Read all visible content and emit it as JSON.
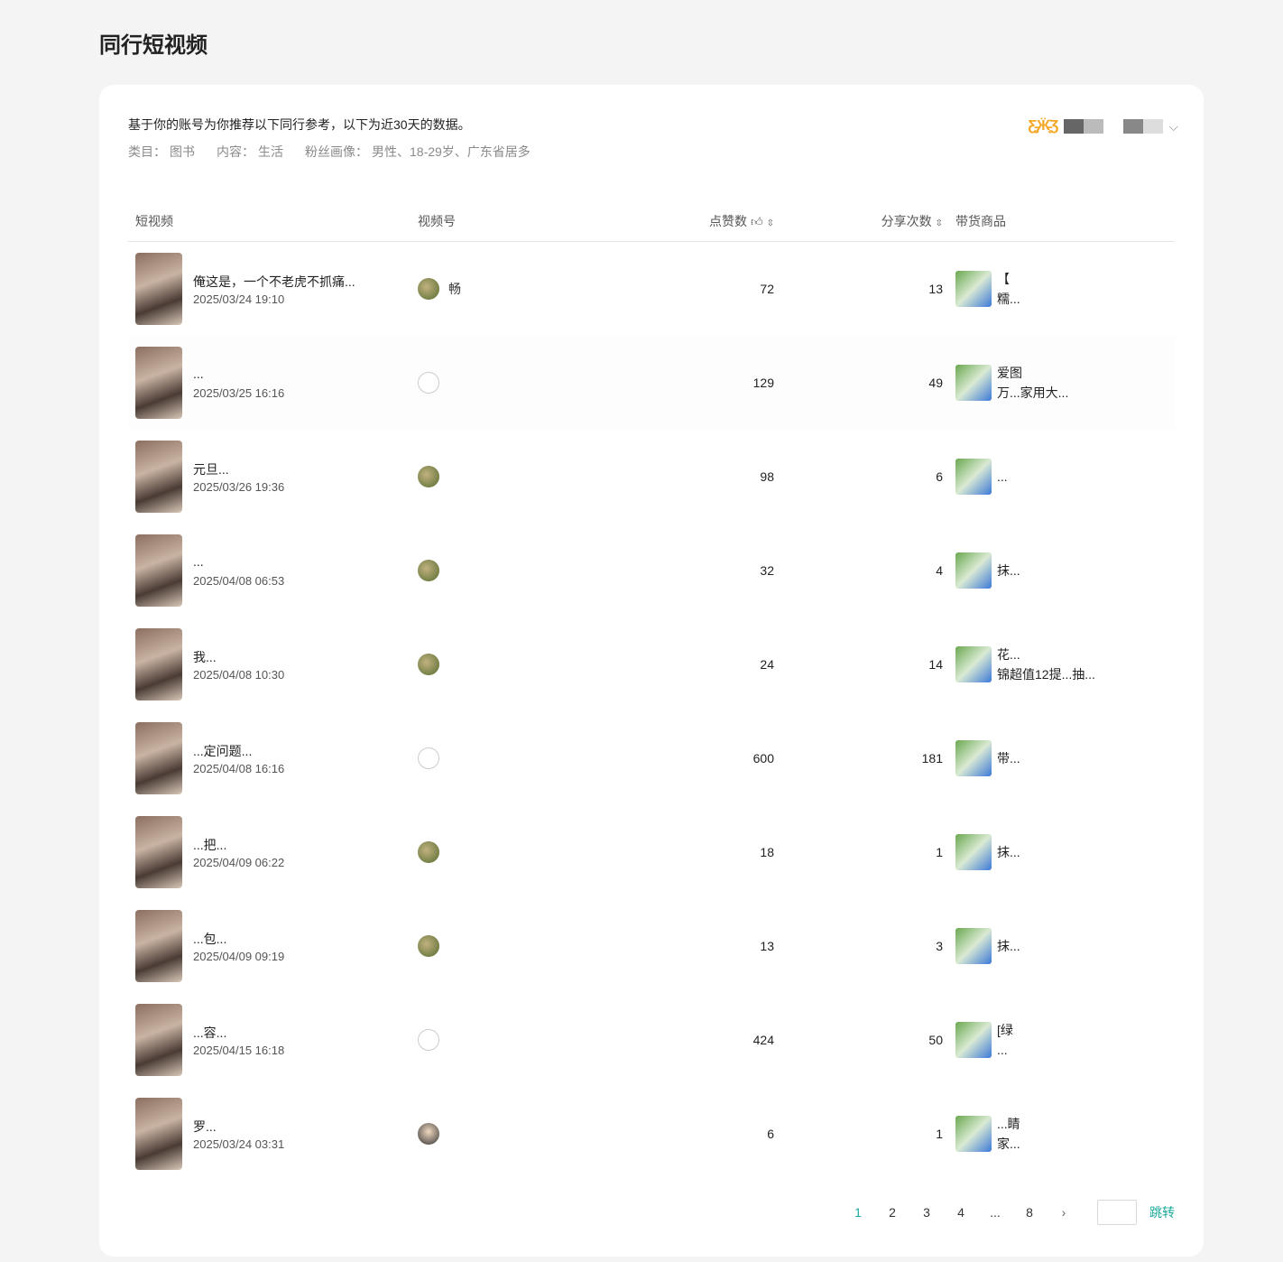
{
  "page_title": "同行短视频",
  "intro": "基于你的账号为你推荐以下同行参考，以下为近30天的数据。",
  "meta": {
    "category_label": "类目：",
    "category": "图书",
    "content_label": "内容：",
    "content": "生活",
    "fans_label": "粉丝画像：",
    "fans": "男性、18-29岁、广东省居多"
  },
  "account_selector": {
    "logo_icon": "butterfly-icon"
  },
  "table": {
    "headers": {
      "video": "短视频",
      "account": "视频号",
      "likes": "点赞数",
      "shares": "分享次数",
      "goods": "带货商品"
    },
    "rows": [
      {
        "title": "俺这是，一个不老虎不抓痛...",
        "date": "2025/03/24 19:10",
        "account": "畅",
        "likes": "72",
        "shares": "13",
        "goods1": "【",
        "goods2": "糯..."
      },
      {
        "title": "...",
        "date": "2025/03/25 16:16",
        "account": "",
        "likes": "129",
        "shares": "49",
        "goods1": "爱图",
        "goods2": "万...家用大..."
      },
      {
        "title": "元旦...",
        "date": "2025/03/26 19:36",
        "account": "",
        "likes": "98",
        "shares": "6",
        "goods1": "",
        "goods2": "..."
      },
      {
        "title": "...",
        "date": "2025/04/08 06:53",
        "account": "",
        "likes": "32",
        "shares": "4",
        "goods1": "",
        "goods2": "抹..."
      },
      {
        "title": "我...",
        "date": "2025/04/08 10:30",
        "account": "",
        "likes": "24",
        "shares": "14",
        "goods1": "花...",
        "goods2": "锦超值12提...抽..."
      },
      {
        "title": "...定问题...",
        "date": "2025/04/08 16:16",
        "account": "",
        "likes": "600",
        "shares": "181",
        "goods1": "",
        "goods2": "带..."
      },
      {
        "title": "...把...",
        "date": "2025/04/09 06:22",
        "account": "",
        "likes": "18",
        "shares": "1",
        "goods1": "",
        "goods2": "抹..."
      },
      {
        "title": "...包...",
        "date": "2025/04/09 09:19",
        "account": "",
        "likes": "13",
        "shares": "3",
        "goods1": "",
        "goods2": "抹..."
      },
      {
        "title": "...容...",
        "date": "2025/04/15 16:18",
        "account": "",
        "likes": "424",
        "shares": "50",
        "goods1": "[绿",
        "goods2": "..."
      },
      {
        "title": "罗...",
        "date": "2025/03/24 03:31",
        "account": "",
        "likes": "6",
        "shares": "1",
        "goods1": "...睛",
        "goods2": "家..."
      }
    ]
  },
  "pagination": {
    "pages": [
      "1",
      "2",
      "3",
      "4",
      "...",
      "8"
    ],
    "current": "1",
    "next": "›",
    "jump_label": "跳转"
  }
}
